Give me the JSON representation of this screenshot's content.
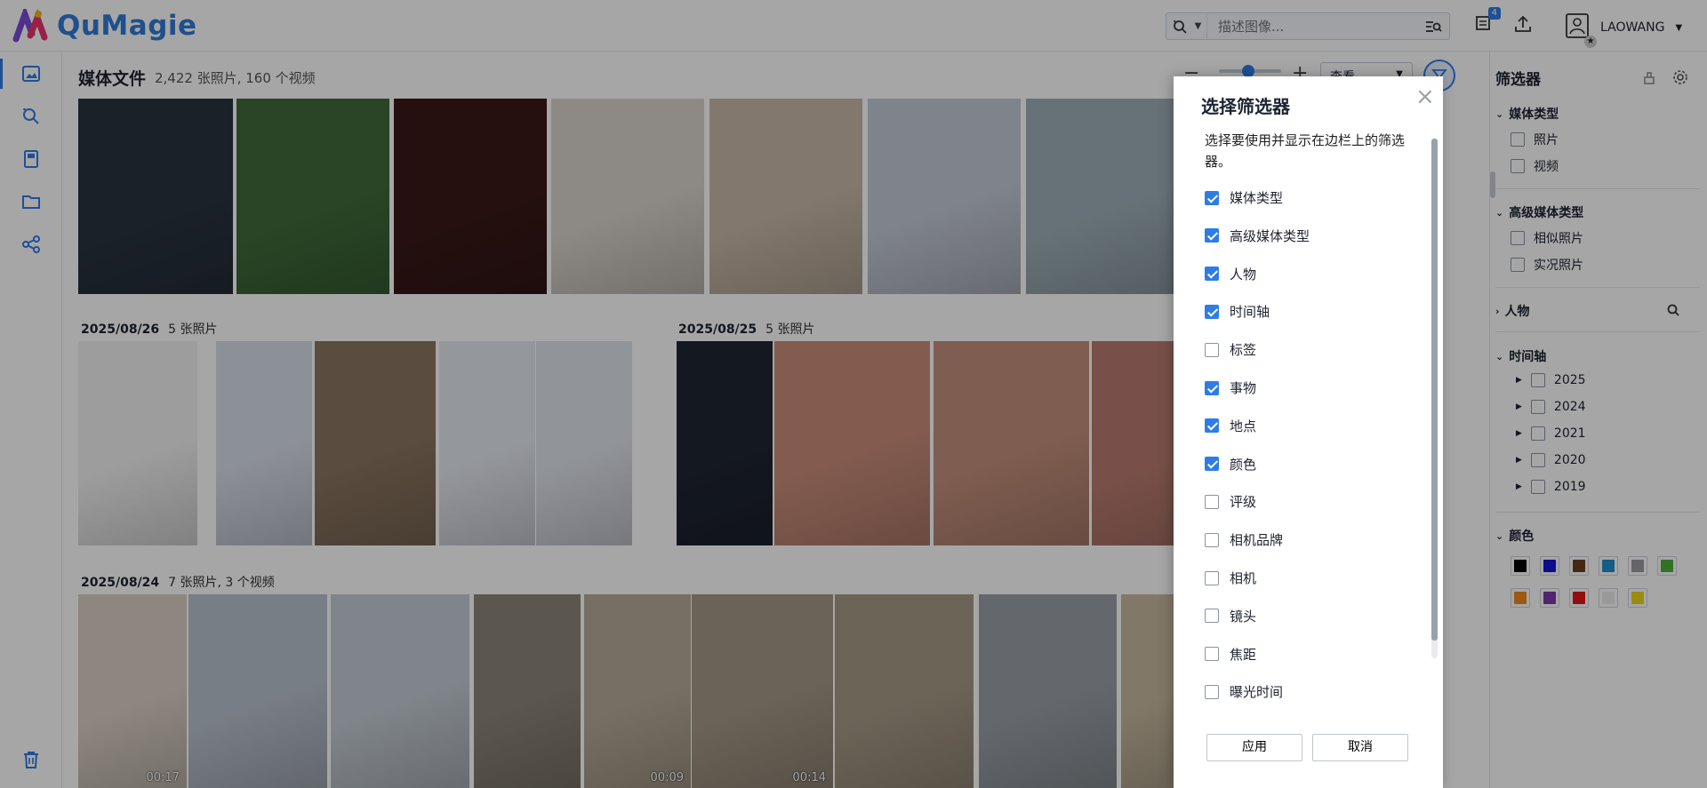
{
  "app": {
    "name": "QuMagie"
  },
  "header": {
    "search_placeholder": "描述图像...",
    "upload_badge": "4",
    "username": "LAOWANG"
  },
  "main": {
    "title": "媒体文件",
    "count": "2,422 张照片, 160 个视频",
    "view_select": "查看",
    "groups": [
      {
        "date": "2025/08/26",
        "summary": "5 张照片"
      },
      {
        "date": "2025/08/25",
        "summary": "5 张照片"
      },
      {
        "date": "2025/08/24",
        "summary": "7 张照片, 3 个视频"
      }
    ],
    "durations": [
      "00:17",
      "00:09",
      "00:14"
    ]
  },
  "filter_panel": {
    "title": "筛选器",
    "media_type": {
      "label": "媒体类型",
      "items": [
        "照片",
        "视频"
      ]
    },
    "advanced_media_type": {
      "label": "高级媒体类型",
      "items": [
        "相似照片",
        "实况照片"
      ]
    },
    "people": {
      "label": "人物"
    },
    "timeline": {
      "label": "时间轴",
      "years": [
        "2025",
        "2024",
        "2021",
        "2020",
        "2019"
      ]
    },
    "color": {
      "label": "颜色",
      "swatches": [
        "#000000",
        "#1414d8",
        "#6b3e1f",
        "#1f8fd0",
        "#9b9b9b",
        "#4fae3c",
        "#f2891e",
        "#7a3aa8",
        "#e01818",
        "#ececec",
        "#ecd81a"
      ]
    }
  },
  "modal": {
    "title": "选择筛选器",
    "description": "选择要使用并显示在边栏上的筛选器。",
    "options": [
      {
        "label": "媒体类型",
        "checked": true
      },
      {
        "label": "高级媒体类型",
        "checked": true
      },
      {
        "label": "人物",
        "checked": true
      },
      {
        "label": "时间轴",
        "checked": true
      },
      {
        "label": "标签",
        "checked": false
      },
      {
        "label": "事物",
        "checked": true
      },
      {
        "label": "地点",
        "checked": true
      },
      {
        "label": "颜色",
        "checked": true
      },
      {
        "label": "评级",
        "checked": false
      },
      {
        "label": "相机品牌",
        "checked": false
      },
      {
        "label": "相机",
        "checked": false
      },
      {
        "label": "镜头",
        "checked": false
      },
      {
        "label": "焦距",
        "checked": false
      },
      {
        "label": "曝光时间",
        "checked": false
      }
    ],
    "apply_label": "应用",
    "cancel_label": "取消"
  },
  "tile_colors": {
    "row1": [
      "#2a3440",
      "#3f6b3a",
      "#3a1818",
      "#d9d4cc",
      "#c9b9a8",
      "#c3c9d6",
      "#9fb0b8"
    ],
    "row2": [
      "#f2f2f2",
      "#d8dde8",
      "#8a7560",
      "#e4e8ef",
      "#dfe3ea",
      "#1f2533",
      "#c98c7a",
      "#c48f7c",
      "#b97c70"
    ],
    "row3": [
      "#d9d0c4",
      "#b9c2cc",
      "#c4ccd4",
      "#8c8578",
      "#b7ab98",
      "#a59886",
      "#a79a86",
      "#9aa0a6",
      "#c7b99f"
    ]
  }
}
